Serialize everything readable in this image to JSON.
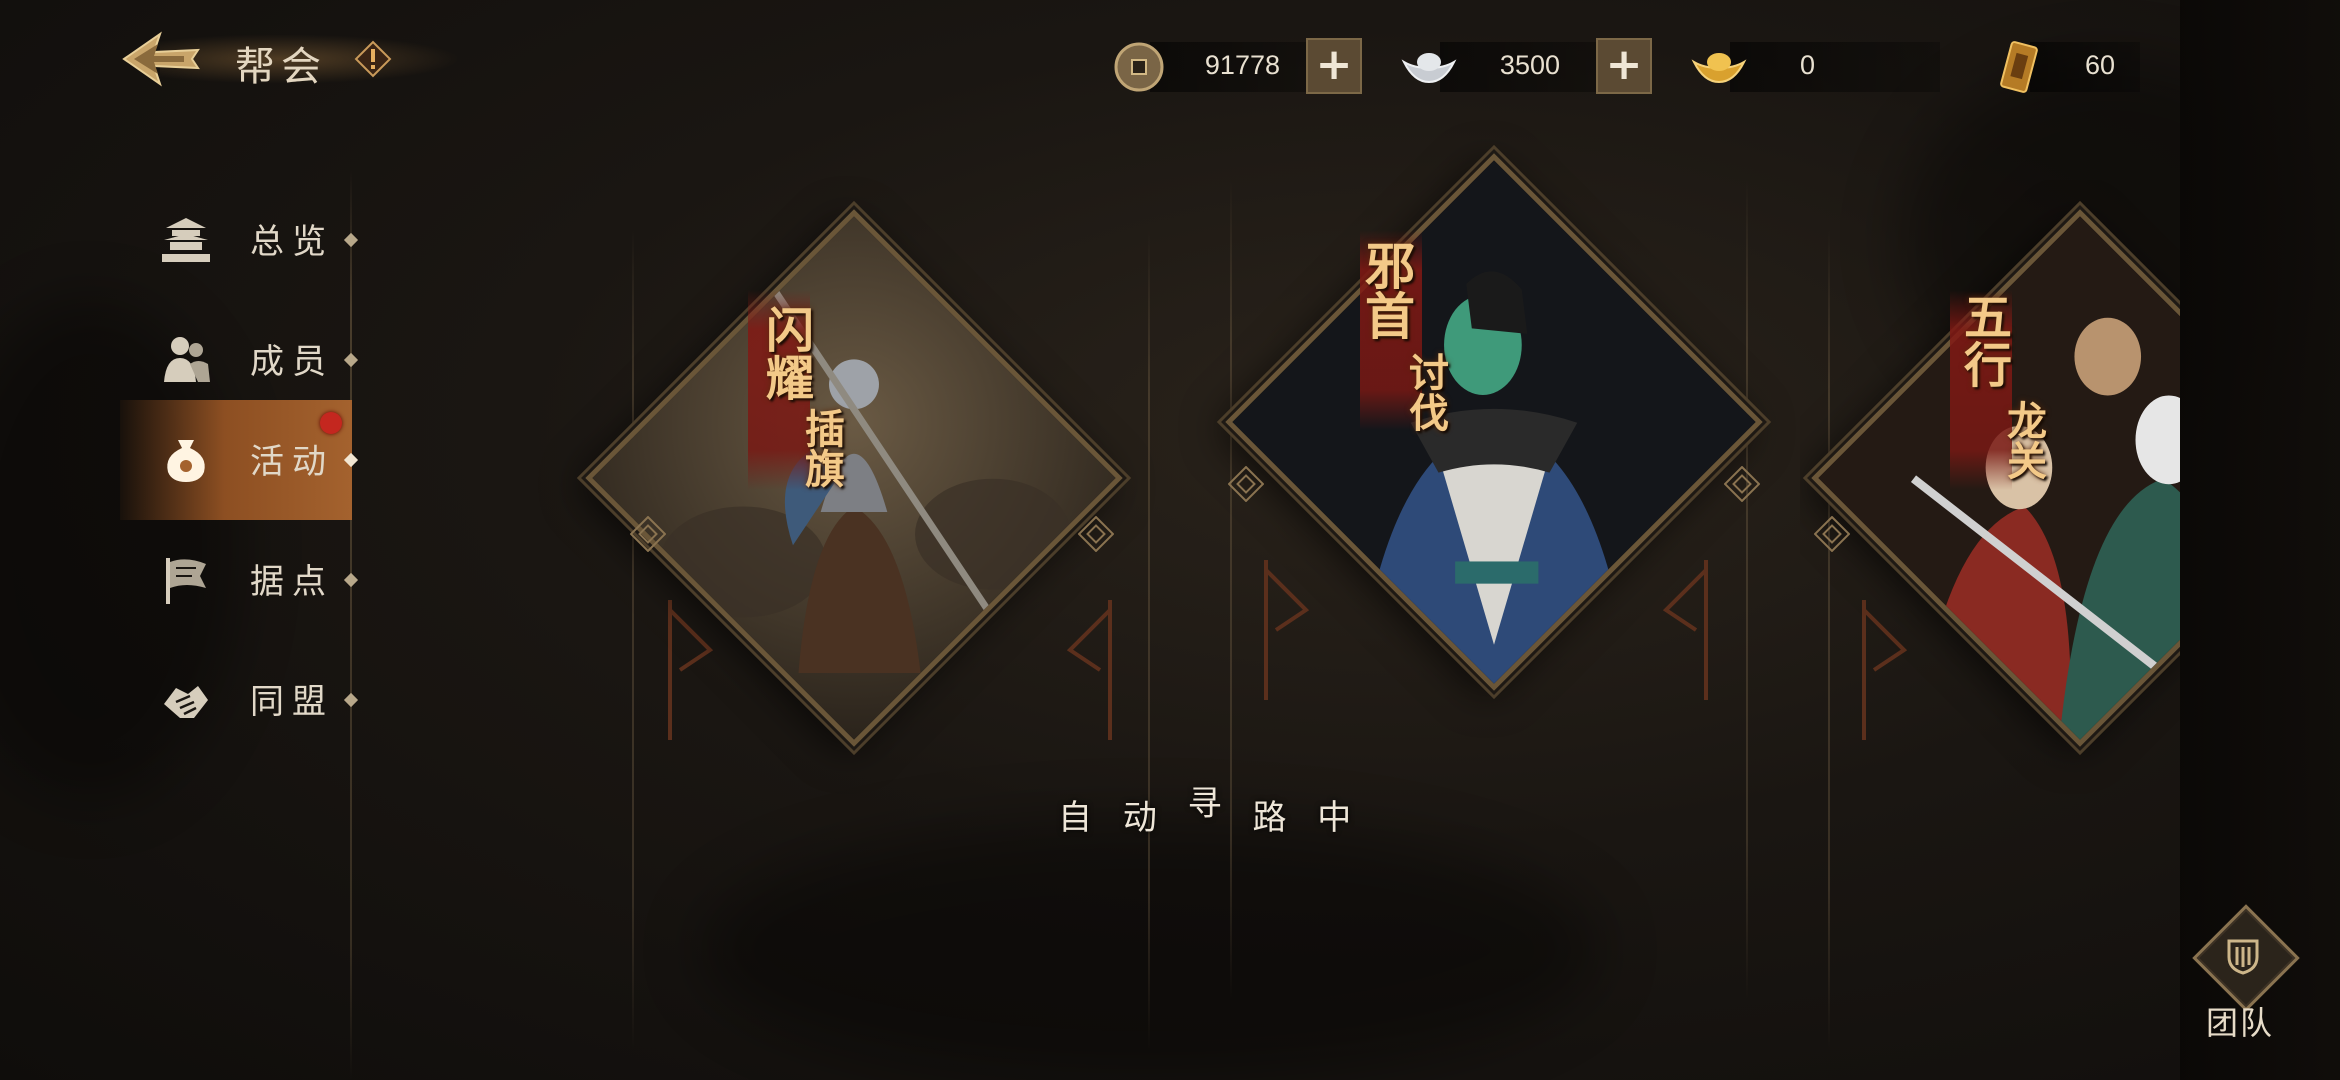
{
  "header": {
    "title": "帮会",
    "back_icon": "back-arrow-icon",
    "info_icon": "exclamation-icon"
  },
  "currencies": [
    {
      "name": "copper-coin",
      "value": "91778",
      "has_plus": true
    },
    {
      "name": "silver-ingot",
      "value": "3500",
      "has_plus": true
    },
    {
      "name": "gold-ingot",
      "value": "0",
      "has_plus": false
    },
    {
      "name": "token",
      "value": "60",
      "has_plus": false
    }
  ],
  "sidebar": {
    "items": [
      {
        "label": "总览",
        "icon": "pagoda-icon",
        "active": false
      },
      {
        "label": "成员",
        "icon": "members-icon",
        "active": false
      },
      {
        "label": "活动",
        "icon": "pouch-icon",
        "active": true,
        "badge": "red-dot"
      },
      {
        "label": "据点",
        "icon": "flag-icon",
        "active": false
      },
      {
        "label": "同盟",
        "icon": "handshake-icon",
        "active": false
      }
    ]
  },
  "cards": [
    {
      "title_a": "闪耀",
      "title_b": "插旗"
    },
    {
      "title_a": "邪首",
      "title_b": "讨伐"
    },
    {
      "title_a": "五行",
      "title_b": "龙关"
    }
  ],
  "status": {
    "chars": [
      "自",
      "动",
      "寻",
      "路",
      "中"
    ]
  },
  "team_button": {
    "label": "团队",
    "icon": "shield-icon"
  },
  "colors": {
    "accent": "#a4622e",
    "frame": "#6a5638",
    "title_gold": "#f3c988",
    "badge_red": "#c4271f"
  }
}
